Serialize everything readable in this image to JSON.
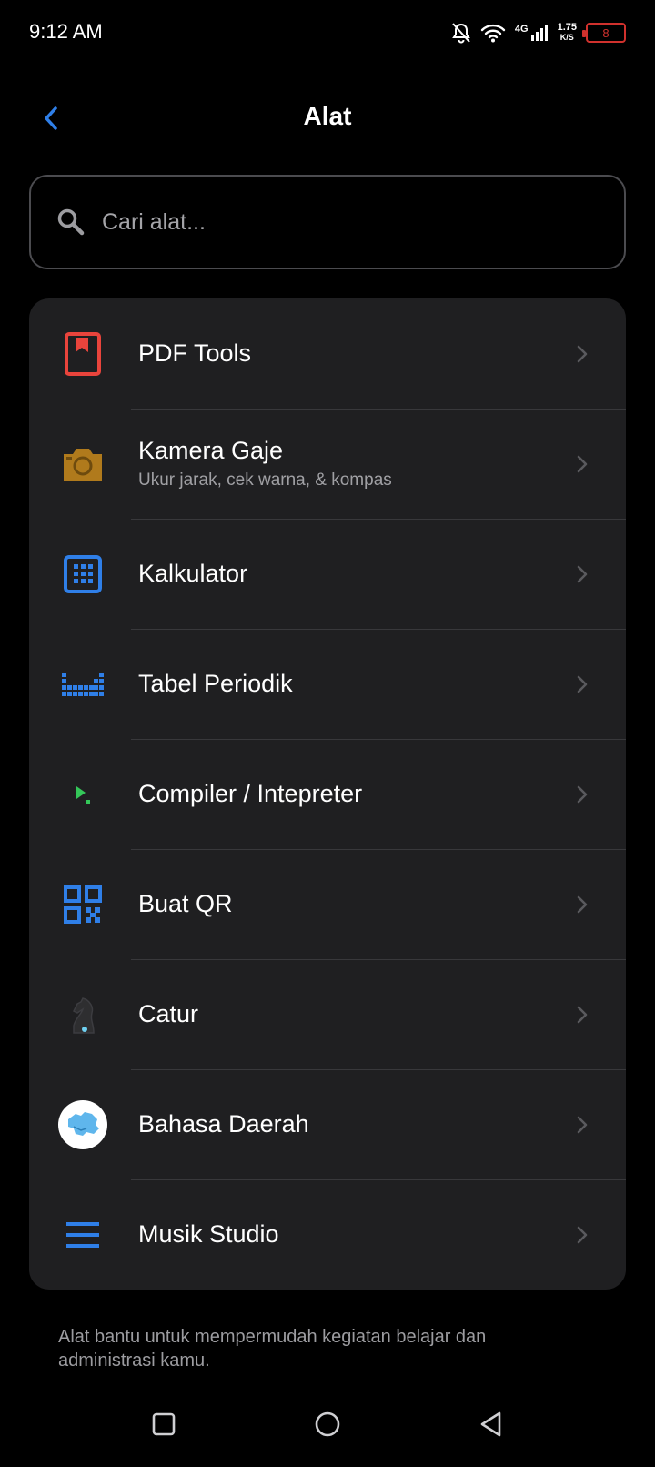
{
  "status_bar": {
    "time": "9:12 AM",
    "network": "4G",
    "speed_value": "1.75",
    "speed_unit": "K/S",
    "battery": "8",
    "icons": [
      "bell-off-icon",
      "wifi-icon",
      "signal-icon",
      "battery-icon"
    ]
  },
  "header": {
    "title": "Alat",
    "back_icon": "chevron-left-icon"
  },
  "search": {
    "placeholder": "Cari alat...",
    "value": ""
  },
  "tools": [
    {
      "label": "PDF Tools",
      "subtitle": "",
      "icon": "pdf-bookmark-icon",
      "color": "#e9443c"
    },
    {
      "label": "Kamera Gaje",
      "subtitle": "Ukur jarak, cek warna, & kompas",
      "icon": "camera-icon",
      "color": "#b07a1c"
    },
    {
      "label": "Kalkulator",
      "subtitle": "",
      "icon": "calculator-icon",
      "color": "#2f7fe8"
    },
    {
      "label": "Tabel Periodik",
      "subtitle": "",
      "icon": "periodic-table-icon",
      "color": "#2f7fe8"
    },
    {
      "label": "Compiler / Intepreter",
      "subtitle": "",
      "icon": "terminal-icon",
      "color": "#34c759"
    },
    {
      "label": "Buat QR",
      "subtitle": "",
      "icon": "qr-code-icon",
      "color": "#2f7fe8"
    },
    {
      "label": "Catur",
      "subtitle": "",
      "icon": "chess-knight-icon",
      "color": "#2e2e30"
    },
    {
      "label": "Bahasa Daerah",
      "subtitle": "",
      "icon": "indonesia-map-icon",
      "color": "#5fb6ec"
    },
    {
      "label": "Musik Studio",
      "subtitle": "",
      "icon": "menu-lines-icon",
      "color": "#2f7fe8"
    }
  ],
  "footer_note": "Alat bantu untuk mempermudah kegiatan belajar dan administrasi kamu.",
  "nav": {
    "icons": [
      "recents-square-icon",
      "home-circle-icon",
      "back-triangle-icon"
    ]
  },
  "colors": {
    "background": "#000000",
    "card": "#1f1f21",
    "accent": "#2f7fe8",
    "muted_text": "#a0a0a4",
    "battery_low": "#d0312d"
  }
}
